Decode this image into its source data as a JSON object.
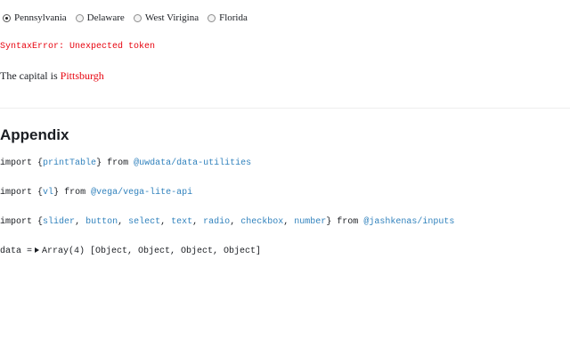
{
  "radios": {
    "options": [
      "Pennsylvania",
      "Delaware",
      "West Virigina",
      "Florida"
    ],
    "selected": "Pennsylvania"
  },
  "error_text": "SyntaxError: Unexpected token",
  "capital": {
    "prefix": "The capital is",
    "city": "Pittsburgh"
  },
  "appendix": {
    "heading": "Appendix",
    "import1": {
      "kw": "import",
      "open": "{",
      "name": "printTable",
      "close": "}",
      "from": "from",
      "source": "@uwdata/data-utilities"
    },
    "import2": {
      "kw": "import",
      "open": "{",
      "name": "vl",
      "close": "}",
      "from": "from",
      "source": "@vega/vega-lite-api"
    },
    "import3": {
      "kw": "import",
      "open": "{",
      "names": [
        "slider",
        "button",
        "select",
        "text",
        "radio",
        "checkbox",
        "number"
      ],
      "close": "}",
      "from": "from",
      "source": "@jashkenas/inputs"
    },
    "data_line": {
      "lhs": "data =",
      "value": "Array(4) [Object, Object, Object, Object]"
    }
  },
  "colors": {
    "error": "#e7040f",
    "code_link": "#3182bd",
    "text": "#1b1e23"
  }
}
